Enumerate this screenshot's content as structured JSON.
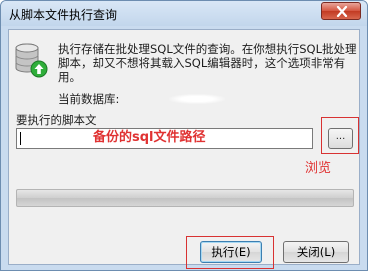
{
  "window": {
    "title": "从脚本文件执行查询",
    "close_icon": "close-icon"
  },
  "dialog": {
    "icon": "database-run-icon",
    "description": "执行存储在批处理SQL文件的查询。在你想执行SQL批处理脚本，却又不想将其载入SQL编辑器时，这个选项非常有用。",
    "current_db_label": "当前数据库:",
    "path_label": "要执行的脚本文",
    "path_value": "",
    "path_annotation": "备份的sql文件路径",
    "browse_label": "...",
    "browse_annotation": "浏览",
    "progress_fraction": 0
  },
  "buttons": {
    "execute": "执行(E)",
    "close": "关闭(L)"
  },
  "colors": {
    "annotation": "#e03232",
    "titlebar": "#c9dbef",
    "close_button": "#c23a22"
  }
}
